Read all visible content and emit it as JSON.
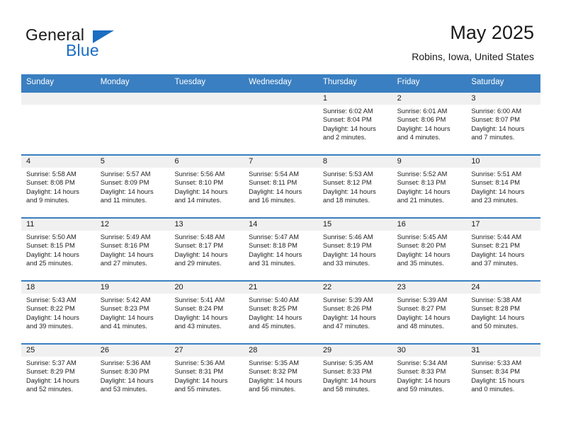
{
  "brand": {
    "word1": "General",
    "word2": "Blue",
    "accent_color": "#1b6ec2"
  },
  "header": {
    "title": "May 2025",
    "subtitle": "Robins, Iowa, United States"
  },
  "calendar": {
    "header_color": "#3a7fc1",
    "weekdays": [
      "Sunday",
      "Monday",
      "Tuesday",
      "Wednesday",
      "Thursday",
      "Friday",
      "Saturday"
    ],
    "weeks": [
      [
        {
          "day": "",
          "sunrise": "",
          "sunset": "",
          "daylight": ""
        },
        {
          "day": "",
          "sunrise": "",
          "sunset": "",
          "daylight": ""
        },
        {
          "day": "",
          "sunrise": "",
          "sunset": "",
          "daylight": ""
        },
        {
          "day": "",
          "sunrise": "",
          "sunset": "",
          "daylight": ""
        },
        {
          "day": "1",
          "sunrise": "Sunrise: 6:02 AM",
          "sunset": "Sunset: 8:04 PM",
          "daylight": "Daylight: 14 hours and 2 minutes."
        },
        {
          "day": "2",
          "sunrise": "Sunrise: 6:01 AM",
          "sunset": "Sunset: 8:06 PM",
          "daylight": "Daylight: 14 hours and 4 minutes."
        },
        {
          "day": "3",
          "sunrise": "Sunrise: 6:00 AM",
          "sunset": "Sunset: 8:07 PM",
          "daylight": "Daylight: 14 hours and 7 minutes."
        }
      ],
      [
        {
          "day": "4",
          "sunrise": "Sunrise: 5:58 AM",
          "sunset": "Sunset: 8:08 PM",
          "daylight": "Daylight: 14 hours and 9 minutes."
        },
        {
          "day": "5",
          "sunrise": "Sunrise: 5:57 AM",
          "sunset": "Sunset: 8:09 PM",
          "daylight": "Daylight: 14 hours and 11 minutes."
        },
        {
          "day": "6",
          "sunrise": "Sunrise: 5:56 AM",
          "sunset": "Sunset: 8:10 PM",
          "daylight": "Daylight: 14 hours and 14 minutes."
        },
        {
          "day": "7",
          "sunrise": "Sunrise: 5:54 AM",
          "sunset": "Sunset: 8:11 PM",
          "daylight": "Daylight: 14 hours and 16 minutes."
        },
        {
          "day": "8",
          "sunrise": "Sunrise: 5:53 AM",
          "sunset": "Sunset: 8:12 PM",
          "daylight": "Daylight: 14 hours and 18 minutes."
        },
        {
          "day": "9",
          "sunrise": "Sunrise: 5:52 AM",
          "sunset": "Sunset: 8:13 PM",
          "daylight": "Daylight: 14 hours and 21 minutes."
        },
        {
          "day": "10",
          "sunrise": "Sunrise: 5:51 AM",
          "sunset": "Sunset: 8:14 PM",
          "daylight": "Daylight: 14 hours and 23 minutes."
        }
      ],
      [
        {
          "day": "11",
          "sunrise": "Sunrise: 5:50 AM",
          "sunset": "Sunset: 8:15 PM",
          "daylight": "Daylight: 14 hours and 25 minutes."
        },
        {
          "day": "12",
          "sunrise": "Sunrise: 5:49 AM",
          "sunset": "Sunset: 8:16 PM",
          "daylight": "Daylight: 14 hours and 27 minutes."
        },
        {
          "day": "13",
          "sunrise": "Sunrise: 5:48 AM",
          "sunset": "Sunset: 8:17 PM",
          "daylight": "Daylight: 14 hours and 29 minutes."
        },
        {
          "day": "14",
          "sunrise": "Sunrise: 5:47 AM",
          "sunset": "Sunset: 8:18 PM",
          "daylight": "Daylight: 14 hours and 31 minutes."
        },
        {
          "day": "15",
          "sunrise": "Sunrise: 5:46 AM",
          "sunset": "Sunset: 8:19 PM",
          "daylight": "Daylight: 14 hours and 33 minutes."
        },
        {
          "day": "16",
          "sunrise": "Sunrise: 5:45 AM",
          "sunset": "Sunset: 8:20 PM",
          "daylight": "Daylight: 14 hours and 35 minutes."
        },
        {
          "day": "17",
          "sunrise": "Sunrise: 5:44 AM",
          "sunset": "Sunset: 8:21 PM",
          "daylight": "Daylight: 14 hours and 37 minutes."
        }
      ],
      [
        {
          "day": "18",
          "sunrise": "Sunrise: 5:43 AM",
          "sunset": "Sunset: 8:22 PM",
          "daylight": "Daylight: 14 hours and 39 minutes."
        },
        {
          "day": "19",
          "sunrise": "Sunrise: 5:42 AM",
          "sunset": "Sunset: 8:23 PM",
          "daylight": "Daylight: 14 hours and 41 minutes."
        },
        {
          "day": "20",
          "sunrise": "Sunrise: 5:41 AM",
          "sunset": "Sunset: 8:24 PM",
          "daylight": "Daylight: 14 hours and 43 minutes."
        },
        {
          "day": "21",
          "sunrise": "Sunrise: 5:40 AM",
          "sunset": "Sunset: 8:25 PM",
          "daylight": "Daylight: 14 hours and 45 minutes."
        },
        {
          "day": "22",
          "sunrise": "Sunrise: 5:39 AM",
          "sunset": "Sunset: 8:26 PM",
          "daylight": "Daylight: 14 hours and 47 minutes."
        },
        {
          "day": "23",
          "sunrise": "Sunrise: 5:39 AM",
          "sunset": "Sunset: 8:27 PM",
          "daylight": "Daylight: 14 hours and 48 minutes."
        },
        {
          "day": "24",
          "sunrise": "Sunrise: 5:38 AM",
          "sunset": "Sunset: 8:28 PM",
          "daylight": "Daylight: 14 hours and 50 minutes."
        }
      ],
      [
        {
          "day": "25",
          "sunrise": "Sunrise: 5:37 AM",
          "sunset": "Sunset: 8:29 PM",
          "daylight": "Daylight: 14 hours and 52 minutes."
        },
        {
          "day": "26",
          "sunrise": "Sunrise: 5:36 AM",
          "sunset": "Sunset: 8:30 PM",
          "daylight": "Daylight: 14 hours and 53 minutes."
        },
        {
          "day": "27",
          "sunrise": "Sunrise: 5:36 AM",
          "sunset": "Sunset: 8:31 PM",
          "daylight": "Daylight: 14 hours and 55 minutes."
        },
        {
          "day": "28",
          "sunrise": "Sunrise: 5:35 AM",
          "sunset": "Sunset: 8:32 PM",
          "daylight": "Daylight: 14 hours and 56 minutes."
        },
        {
          "day": "29",
          "sunrise": "Sunrise: 5:35 AM",
          "sunset": "Sunset: 8:33 PM",
          "daylight": "Daylight: 14 hours and 58 minutes."
        },
        {
          "day": "30",
          "sunrise": "Sunrise: 5:34 AM",
          "sunset": "Sunset: 8:33 PM",
          "daylight": "Daylight: 14 hours and 59 minutes."
        },
        {
          "day": "31",
          "sunrise": "Sunrise: 5:33 AM",
          "sunset": "Sunset: 8:34 PM",
          "daylight": "Daylight: 15 hours and 0 minutes."
        }
      ]
    ]
  }
}
